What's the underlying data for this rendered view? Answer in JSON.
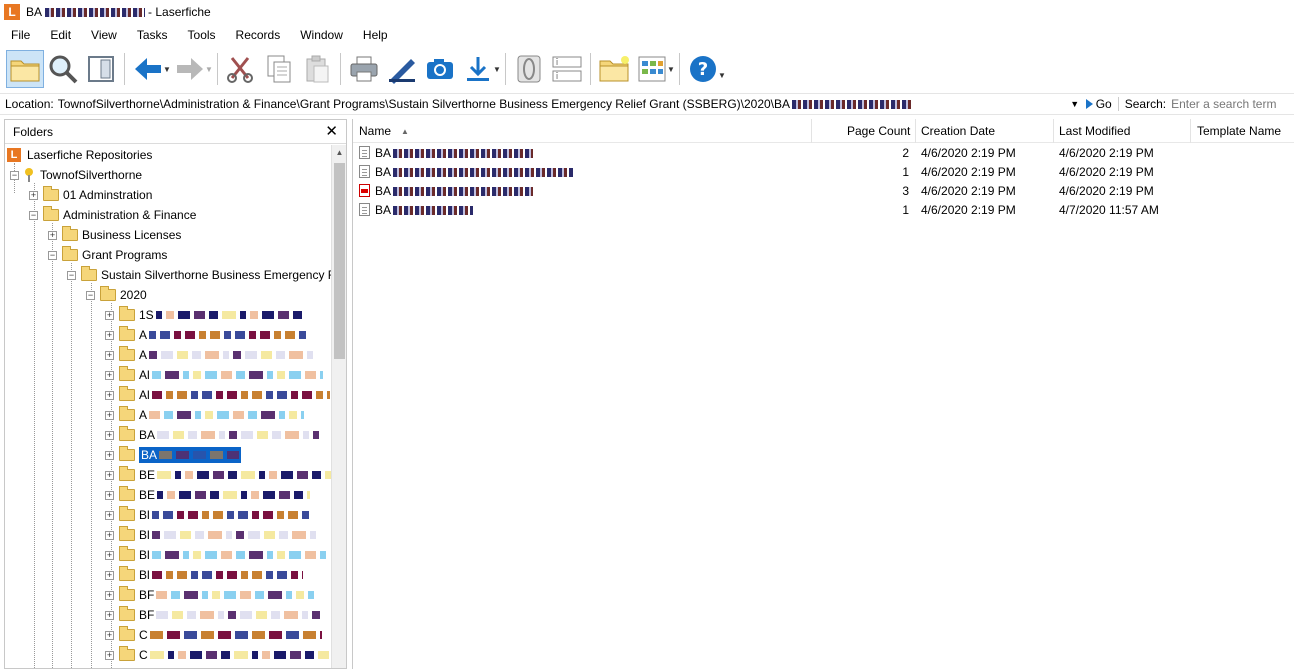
{
  "app": {
    "title_prefix": "BA",
    "title_suffix": "- Laserfiche",
    "icon_letter": "L"
  },
  "menu": [
    "File",
    "Edit",
    "View",
    "Tasks",
    "Tools",
    "Records",
    "Window",
    "Help"
  ],
  "toolbar": {
    "icons": [
      "folder-browser-icon",
      "search-icon",
      "preview-pane-icon",
      "back-arrow-icon",
      "forward-arrow-icon",
      "cut-icon",
      "copy-icon",
      "paste-icon",
      "print-icon",
      "scan-icon",
      "snapshot-icon",
      "download-icon",
      "metadata-icon",
      "fields-icon",
      "new-folder-icon",
      "view-mode-icon",
      "help-icon"
    ]
  },
  "location": {
    "label": "Location:",
    "path": "TownofSilverthorne\\Administration & Finance\\Grant Programs\\Sustain Silverthorne Business Emergency Relief Grant (SSBERG)\\2020\\BA",
    "go_label": "Go",
    "search_label": "Search:",
    "search_placeholder": "Enter a search term"
  },
  "folders_panel": {
    "title": "Folders",
    "close_label": "✕",
    "tree": {
      "root": "Laserfiche Repositories",
      "repository": "TownofSilverthorne",
      "folder_01": "01 Adminstration",
      "admin_finance": "Administration & Finance",
      "business_licenses": "Business Licenses",
      "grant_programs": "Grant Programs",
      "ssberg": "Sustain Silverthorne Business Emergency Re",
      "year": "2020",
      "children": [
        "1S",
        "A",
        "A",
        "Al",
        "Al",
        "A",
        "BA",
        "BA",
        "BE",
        "BE",
        "Bl",
        "Bl",
        "Bl",
        "Bl",
        "BF",
        "BF",
        "C",
        "C"
      ],
      "selected_index": 7
    }
  },
  "file_list": {
    "columns": {
      "name": "Name",
      "page_count": "Page Count",
      "creation_date": "Creation Date",
      "last_modified": "Last Modified",
      "template_name": "Template Name"
    },
    "rows": [
      {
        "name": "BA",
        "type": "document",
        "page_count": "2",
        "creation_date": "4/6/2020 2:19 PM",
        "last_modified": "4/6/2020 2:19 PM"
      },
      {
        "name": "BA",
        "type": "document",
        "page_count": "1",
        "creation_date": "4/6/2020 2:19 PM",
        "last_modified": "4/6/2020 2:19 PM"
      },
      {
        "name": "BA",
        "type": "pdf",
        "page_count": "3",
        "creation_date": "4/6/2020 2:19 PM",
        "last_modified": "4/6/2020 2:19 PM"
      },
      {
        "name": "BA",
        "type": "document",
        "page_count": "1",
        "creation_date": "4/6/2020 2:19 PM",
        "last_modified": "4/7/2020 11:57 AM"
      }
    ]
  },
  "colors": {
    "accent": "#0a64c8",
    "brand": "#e87722",
    "folder": "#f5d67a",
    "toolbar_blue": "#1a73c7"
  }
}
